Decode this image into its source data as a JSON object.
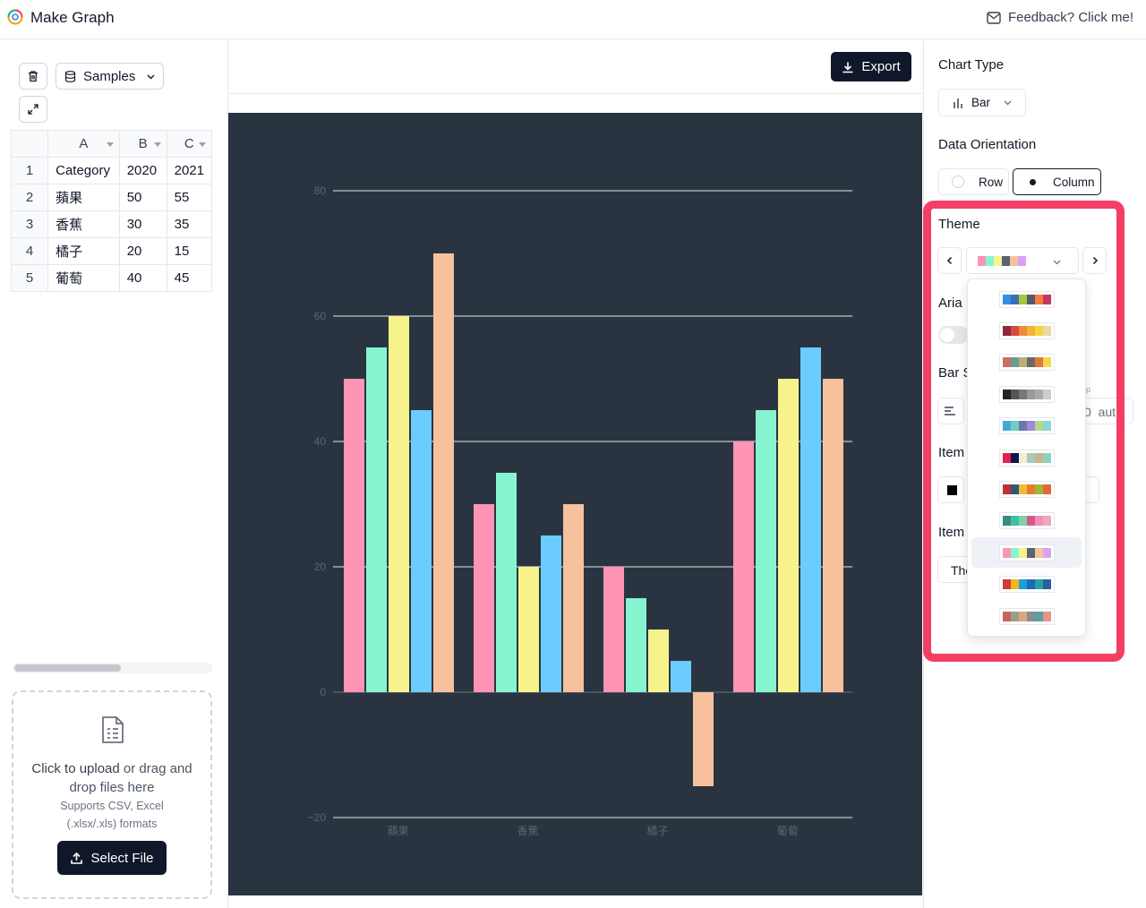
{
  "header": {
    "title": "Make Graph",
    "feedback_label": "Feedback? Click me!"
  },
  "toolbar": {
    "samples_label": "Samples",
    "export_label": "Export"
  },
  "sheet": {
    "columns": [
      "A",
      "B",
      "C"
    ],
    "rows": [
      {
        "num": "1",
        "a": "Category",
        "b": "2020",
        "c": "2021"
      },
      {
        "num": "2",
        "a": "蘋果",
        "b": "50",
        "c": "55"
      },
      {
        "num": "3",
        "a": "香蕉",
        "b": "30",
        "c": "35"
      },
      {
        "num": "4",
        "a": "橘子",
        "b": "20",
        "c": "15"
      },
      {
        "num": "5",
        "a": "葡萄",
        "b": "40",
        "c": "45"
      }
    ]
  },
  "upload": {
    "click_text": "Click to upload",
    "rest_text": " or drag and drop files here",
    "formats_text": "Supports CSV, Excel (.xlsx/.xls) formats",
    "select_label": "Select File"
  },
  "settings": {
    "chart_type_label": "Chart Type",
    "chart_type_value": "Bar",
    "orientation_label": "Data Orientation",
    "orientation_row": "Row",
    "orientation_column": "Column",
    "theme_label": "Theme",
    "aria_partial": "Aria",
    "bar_partial": "Bar S",
    "item1_partial": "Item",
    "item2_partial": "Item",
    "input_partial": "0  aut",
    "theme_btn_partial": "The",
    "tiny_label_partial": "p"
  },
  "themes": [
    [
      "#2e91e5",
      "#3d6eb5",
      "#a4c639",
      "#555a6b",
      "#f47d3a",
      "#c1395d"
    ],
    [
      "#8a2a3c",
      "#d74c3c",
      "#ec8a3e",
      "#f5b335",
      "#f4d63d",
      "#e9d89f"
    ],
    [
      "#c86e62",
      "#6e9b8f",
      "#b9b17b",
      "#6a6a6a",
      "#e1773b",
      "#f2d64f"
    ],
    [
      "#222222",
      "#555555",
      "#777777",
      "#999999",
      "#aaaaaa",
      "#cccccc"
    ],
    [
      "#44a8d8",
      "#6ccfc2",
      "#6f77a8",
      "#9a8be0",
      "#b5d985",
      "#8ad6d9"
    ],
    [
      "#e4214c",
      "#15154a",
      "#f5ecd6",
      "#a9cbbf",
      "#c8b48a",
      "#8fd0c3"
    ],
    [
      "#c0303a",
      "#2f5a73",
      "#f2b93b",
      "#e87b2c",
      "#9ab83c",
      "#e5663f"
    ],
    [
      "#3b8a7e",
      "#3cc2a6",
      "#7dd3a8",
      "#d6588b",
      "#ef90b7",
      "#f1a7c2"
    ],
    [
      "#ff94b4",
      "#86f5cf",
      "#f7f38c",
      "#5a6270",
      "#f7c19e",
      "#d9a2f0"
    ],
    [
      "#cf3a3a",
      "#f2b81e",
      "#1f9bd8",
      "#1d68b8",
      "#24a3a0",
      "#2a5f9e"
    ],
    [
      "#c7635d",
      "#9e9e87",
      "#d9a87e",
      "#8c8c8c",
      "#5c9fa4",
      "#e8938a"
    ]
  ],
  "current_theme": [
    "#ff94b4",
    "#86f5cf",
    "#f7f38c",
    "#5a6270",
    "#f7c19e",
    "#d9a2f0"
  ],
  "chart_data": {
    "type": "bar",
    "categories": [
      "蘋果",
      "香蕉",
      "橘子",
      "葡萄"
    ],
    "series": [
      {
        "values": [
          50,
          30,
          20,
          40
        ],
        "color": "#ff94b4"
      },
      {
        "values": [
          55,
          35,
          15,
          45
        ],
        "color": "#86f5cf"
      },
      {
        "values": [
          60,
          20,
          10,
          50
        ],
        "color": "#f7f38c"
      },
      {
        "values": [
          45,
          25,
          5,
          55
        ],
        "color": "#6ccbff"
      },
      {
        "values": [
          70,
          30,
          -15,
          50
        ],
        "color": "#f7c19e"
      }
    ],
    "yticks": [
      "80",
      "60",
      "40",
      "20",
      "0",
      "−20"
    ],
    "ylim": [
      -20,
      80
    ],
    "grid": true,
    "background": "#2a3440"
  }
}
